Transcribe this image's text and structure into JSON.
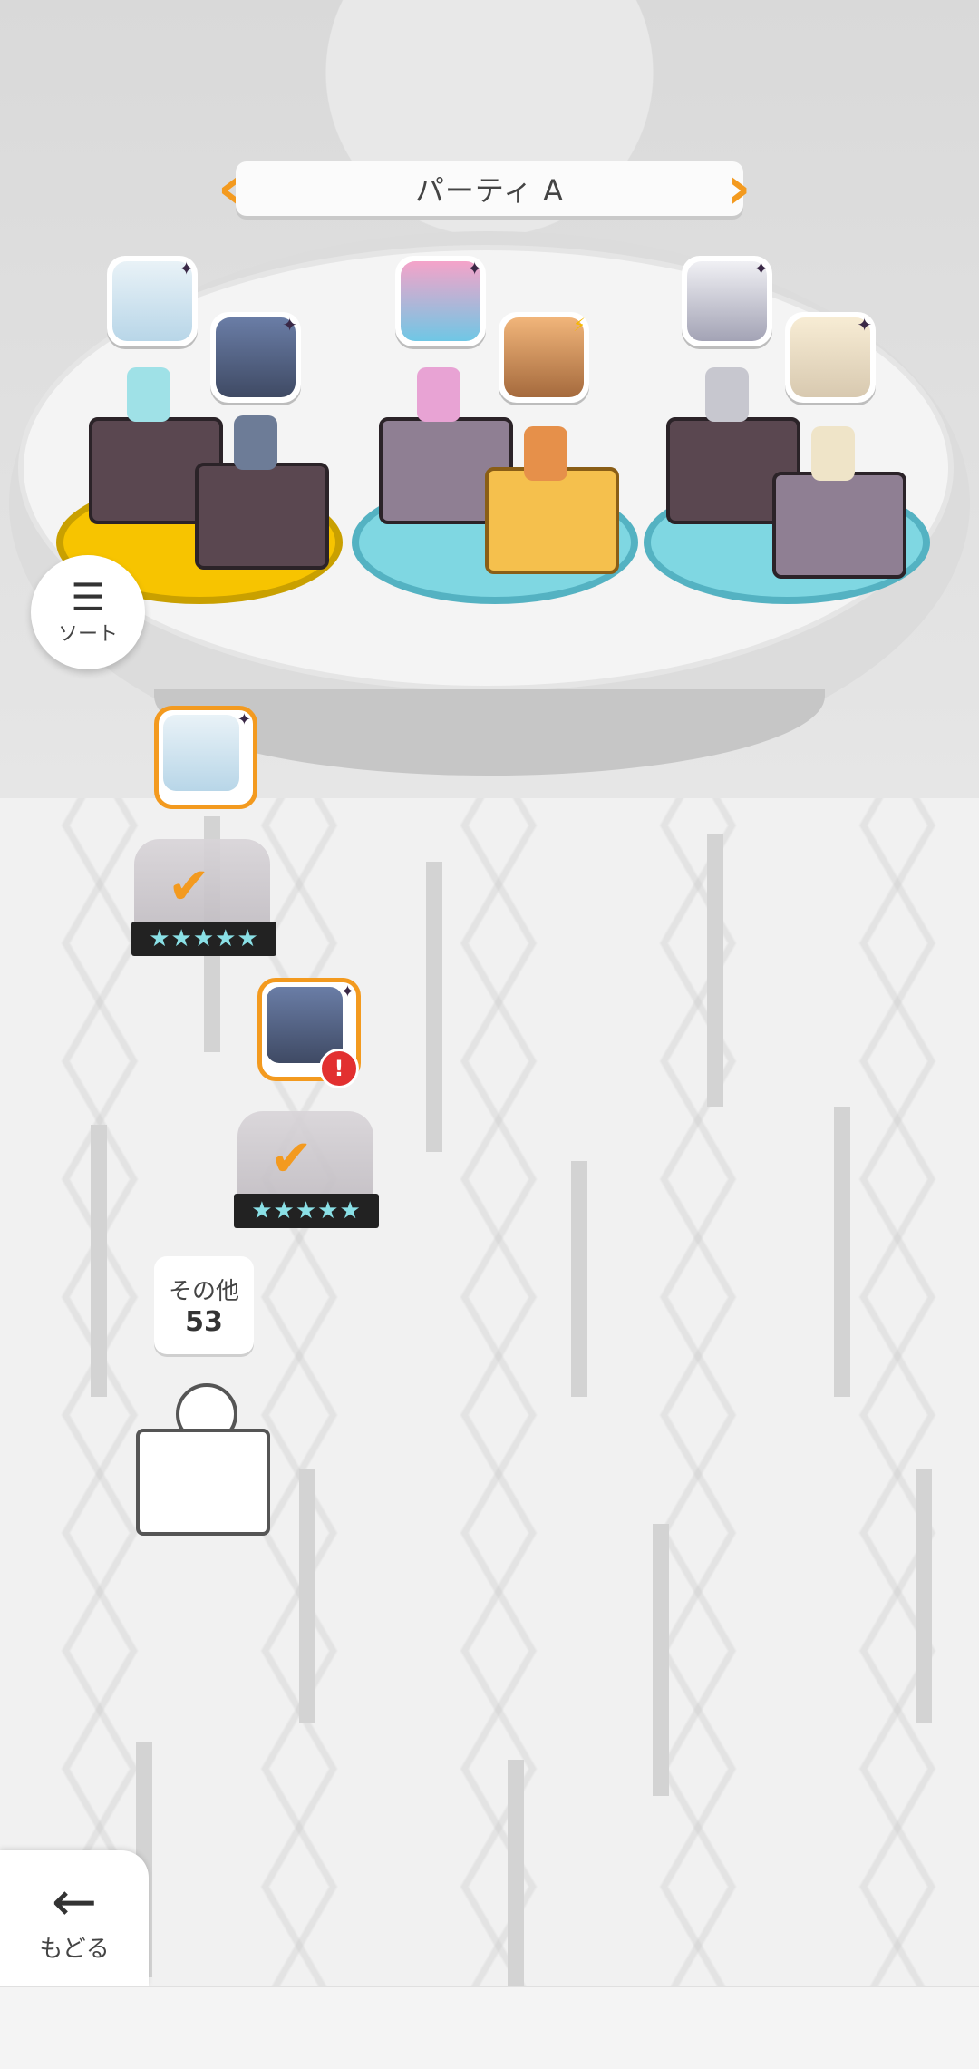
{
  "party": {
    "title": "パーティ A",
    "prev_arrow": "‹",
    "next_arrow": "›"
  },
  "sort": {
    "label": "ソート",
    "icon": "sort-icon"
  },
  "back": {
    "label": "もどる",
    "icon": "arrow-left-icon"
  },
  "others": {
    "label": "その他",
    "count": "53"
  },
  "units": [
    {
      "rarity": "★★★★★",
      "status": "selected"
    },
    {
      "rarity": "★★★★★",
      "status": "selected",
      "alert": "!"
    }
  ],
  "colors": {
    "accent": "#f39a1f",
    "alert": "#e23030",
    "pad_cyan": "#7fd7e2",
    "pad_yellow": "#f7c400"
  }
}
